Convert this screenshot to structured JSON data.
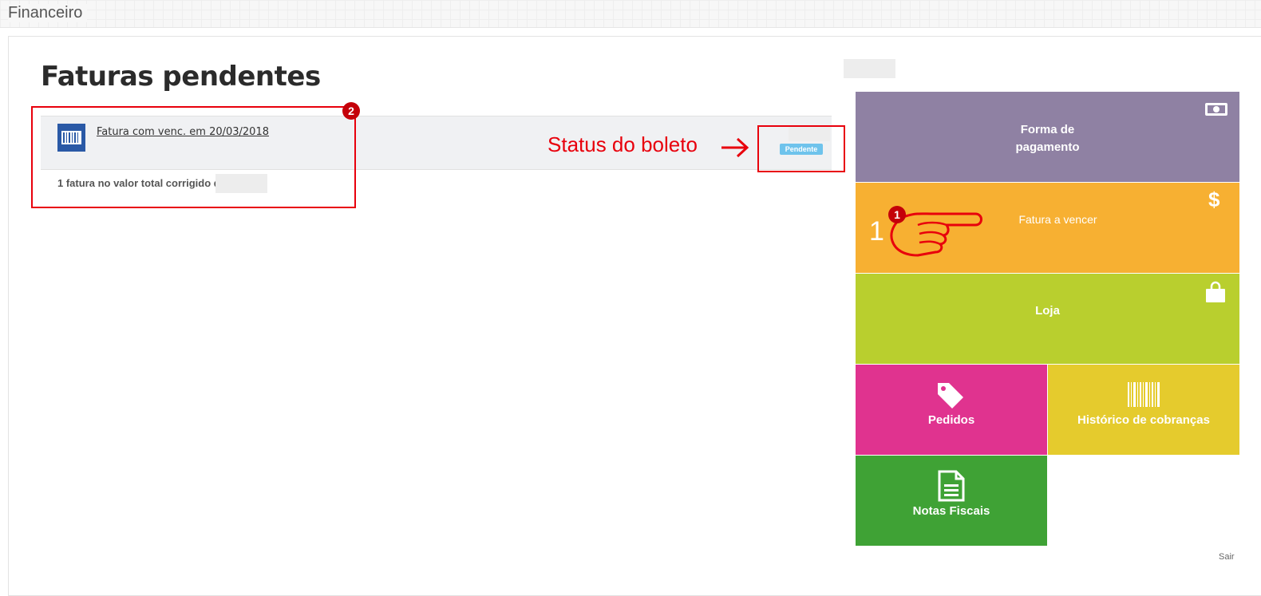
{
  "header": {
    "title": "Financeiro"
  },
  "page": {
    "title": "Faturas pendentes"
  },
  "invoice": {
    "link_text": "Fatura com venc. em 20/03/2018",
    "status": "Pendente",
    "summary": "1 fatura no valor total corrigido de"
  },
  "annotations": {
    "status_label": "Status do boleto",
    "marker_1": "1",
    "marker_2": "2"
  },
  "tiles": {
    "forma_pagamento": {
      "line1": "Forma de",
      "line2": "pagamento",
      "color": "#8f81a3"
    },
    "fatura_vencer": {
      "label": "Fatura a vencer",
      "count": "1",
      "color": "#f7b032"
    },
    "loja": {
      "label": "Loja",
      "color": "#b9cf2e"
    },
    "pedidos": {
      "label": "Pedidos",
      "color": "#e0338f"
    },
    "historico": {
      "label": "Histórico de cobranças",
      "color": "#e5cb2d"
    },
    "notas": {
      "label": "Notas Fiscais",
      "color": "#3fa235"
    }
  },
  "footer": {
    "logout": "Sair"
  },
  "icons": [
    "banknote-icon",
    "dollar-icon",
    "shopping-bag-icon",
    "tag-icon",
    "barcode-icon",
    "document-icon",
    "pointing-hand-icon",
    "arrow-right-icon"
  ]
}
